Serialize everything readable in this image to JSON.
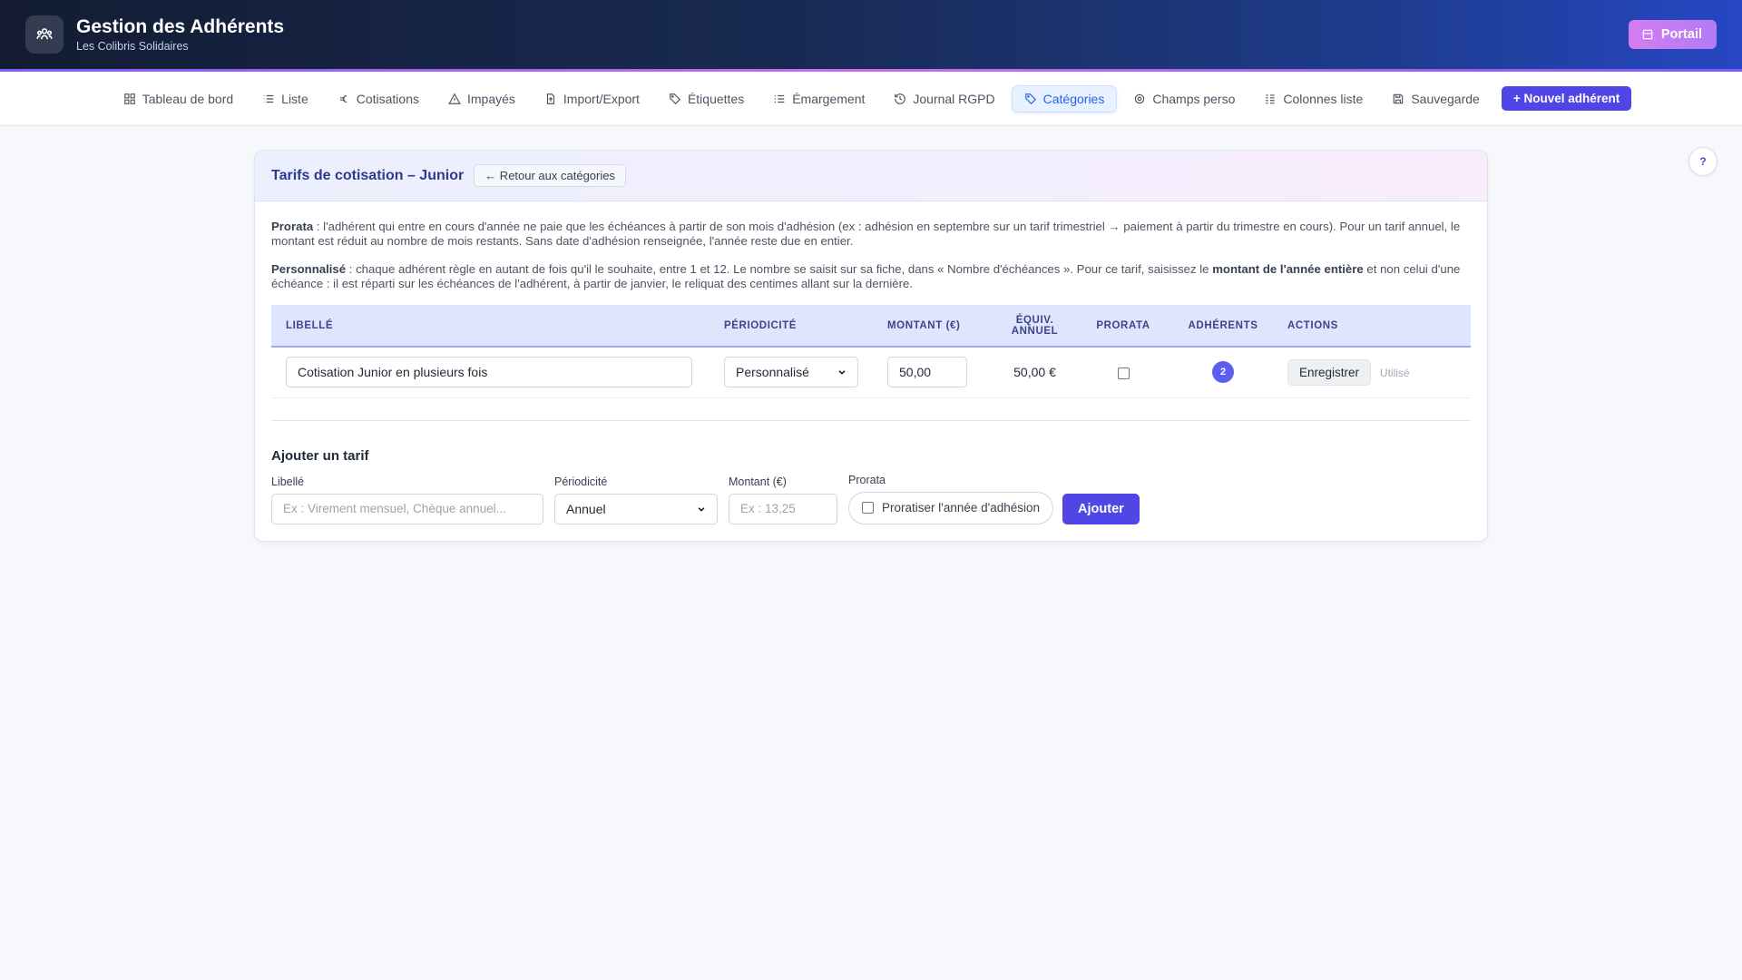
{
  "header": {
    "title": "Gestion des Adhérents",
    "subtitle": "Les Colibris Solidaires",
    "portal_label": "Portail"
  },
  "nav": {
    "items": [
      {
        "label": "Tableau de bord",
        "icon": "grid-icon"
      },
      {
        "label": "Liste",
        "icon": "list-icon"
      },
      {
        "label": "Cotisations",
        "icon": "euro-icon"
      },
      {
        "label": "Impayés",
        "icon": "warning-icon"
      },
      {
        "label": "Import/Export",
        "icon": "file-transfer-icon"
      },
      {
        "label": "Étiquettes",
        "icon": "tag-icon"
      },
      {
        "label": "Émargement",
        "icon": "checklist-icon"
      },
      {
        "label": "Journal RGPD",
        "icon": "history-icon"
      },
      {
        "label": "Catégories",
        "icon": "tag-icon"
      },
      {
        "label": "Champs perso",
        "icon": "gear-icon"
      },
      {
        "label": "Colonnes liste",
        "icon": "columns-icon"
      },
      {
        "label": "Sauvegarde",
        "icon": "save-icon"
      }
    ],
    "active": "Catégories",
    "new_member_label": "+ Nouvel adhérent"
  },
  "help_label": "?",
  "card": {
    "title": "Tarifs de cotisation – Junior",
    "back_label": "← Retour aux catégories",
    "info": {
      "prorata_term": "Prorata",
      "prorata_text": " : l'adhérent qui entre en cours d'année ne paie que les échéances à partir de son mois d'adhésion (ex : adhésion en septembre sur un tarif trimestriel → paiement à partir du trimestre en cours). Pour un tarif annuel, le montant est réduit au nombre de mois restants. Sans date d'adhésion renseignée, l'année reste due en entier.",
      "custom_term": "Personnalisé",
      "custom_text_1": " : chaque adhérent règle en autant de fois qu'il le souhaite, entre 1 et 12. Le nombre se saisit sur sa fiche, dans « Nombre d'échéances ». Pour ce tarif, saisissez le ",
      "custom_bold": "montant de l'année entière",
      "custom_text_2": " et non celui d'une échéance : il est réparti sur les échéances de l'adhérent, à partir de janvier, le reliquat des centimes allant sur la dernière."
    },
    "table": {
      "headers": {
        "label": "LIBELLÉ",
        "periodicity": "PÉRIODICITÉ",
        "amount": "MONTANT (€)",
        "annual_1": "ÉQUIV.",
        "annual_2": "ANNUEL",
        "prorata": "PRORATA",
        "members": "ADHÉRENTS",
        "actions": "ACTIONS"
      },
      "rows": [
        {
          "label": "Cotisation Junior en plusieurs fois",
          "periodicity": "Personnalisé",
          "amount": "50,00",
          "annual": "50,00 €",
          "prorata": false,
          "members": "2",
          "save_label": "Enregistrer",
          "status": "Utilisé"
        }
      ]
    },
    "add_form": {
      "title": "Ajouter un tarif",
      "label_label": "Libellé",
      "label_placeholder": "Ex : Virement mensuel, Chèque annuel...",
      "periodicity_label": "Périodicité",
      "periodicity_value": "Annuel",
      "amount_label": "Montant (€)",
      "amount_placeholder": "Ex : 13,25",
      "prorata_label": "Prorata",
      "prorata_checkbox_label": "Proratiser l'année d'adhésion",
      "submit_label": "Ajouter"
    }
  },
  "colors": {
    "accent": "#4f46e5",
    "active_nav": "#2563eb",
    "header_start": "#131c33",
    "header_end": "#2747c4"
  }
}
